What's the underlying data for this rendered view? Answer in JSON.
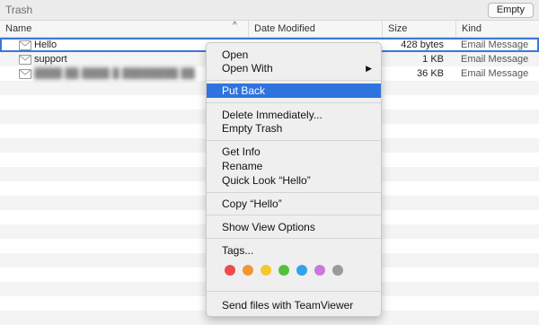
{
  "window": {
    "title": "Trash",
    "empty_button": "Empty"
  },
  "columns": {
    "name": "Name",
    "date": "Date Modified",
    "size": "Size",
    "kind": "Kind",
    "sort_arrow": "^"
  },
  "files": [
    {
      "name": "Hello",
      "size": "428 bytes",
      "kind": "Email Message",
      "selected": true
    },
    {
      "name": "support",
      "size": "1 KB",
      "kind": "Email Message",
      "selected": false
    },
    {
      "name": "████ ██ ████ █ ████████ ██",
      "size": "36 KB",
      "kind": "Email Message",
      "selected": false
    }
  ],
  "context_menu": {
    "open": "Open",
    "open_with": "Open With",
    "put_back": "Put Back",
    "delete_immediately": "Delete Immediately...",
    "empty_trash": "Empty Trash",
    "get_info": "Get Info",
    "rename": "Rename",
    "quick_look": "Quick Look “Hello”",
    "copy": "Copy “Hello”",
    "show_view_options": "Show View Options",
    "tags": "Tags...",
    "send_teamviewer": "Send files with TeamViewer",
    "submenu_arrow": "▶",
    "tag_colors": [
      "#ef4b4b",
      "#f29633",
      "#f5c830",
      "#52c23d",
      "#33a2ea",
      "#c978dd",
      "#9a9a9a"
    ]
  }
}
